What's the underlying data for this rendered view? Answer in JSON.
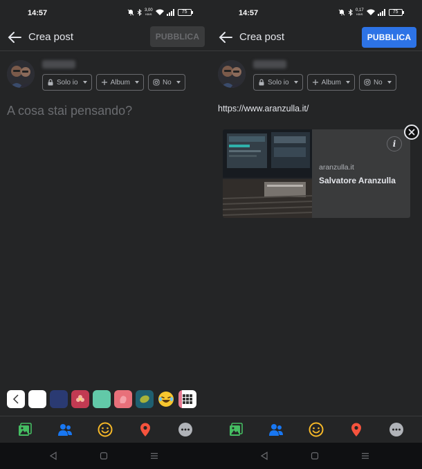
{
  "status_bar": {
    "left_time": "14:57",
    "right_time": "14:57",
    "left_speed": "3,00",
    "right_speed": "0,17",
    "speed_unit": "KB/S",
    "battery": "75"
  },
  "composer": {
    "title": "Crea post",
    "publish_label": "PUBBLICA",
    "audience": {
      "privacy_label": "Solo io",
      "album_label": "Album",
      "instagram_label": "No"
    },
    "placeholder": "A cosa stai pensando?",
    "posted_url": "https://www.aranzulla.it/"
  },
  "link_preview": {
    "domain": "aranzulla.it",
    "title": "Salvatore Aranzulla",
    "info_glyph": "i"
  },
  "background_swatches": [
    {
      "name": "white",
      "color": "#ffffff"
    },
    {
      "name": "navy",
      "color": "#2a3a72"
    },
    {
      "name": "flowers",
      "color": "#c23a52"
    },
    {
      "name": "mint",
      "color": "#62c9a8"
    },
    {
      "name": "pink-hand",
      "color": "#e8707a"
    },
    {
      "name": "teal-abstract",
      "color": "#1f5f70"
    },
    {
      "name": "laughing-emoji",
      "color": "#242526"
    },
    {
      "name": "grid",
      "color": "#ffffff"
    }
  ],
  "colors": {
    "accent": "#2d73e6",
    "photo_icon": "#45bd62",
    "tag_icon": "#1877f2",
    "feeling_icon": "#f7b928",
    "location_icon": "#f5533d",
    "more_icon": "#b0b3b8"
  },
  "icons": [
    "back-arrow-icon",
    "lock-icon",
    "plus-icon",
    "instagram-icon",
    "photo-icon",
    "tag-people-icon",
    "feeling-icon",
    "location-icon",
    "more-icon",
    "info-icon",
    "close-icon"
  ]
}
